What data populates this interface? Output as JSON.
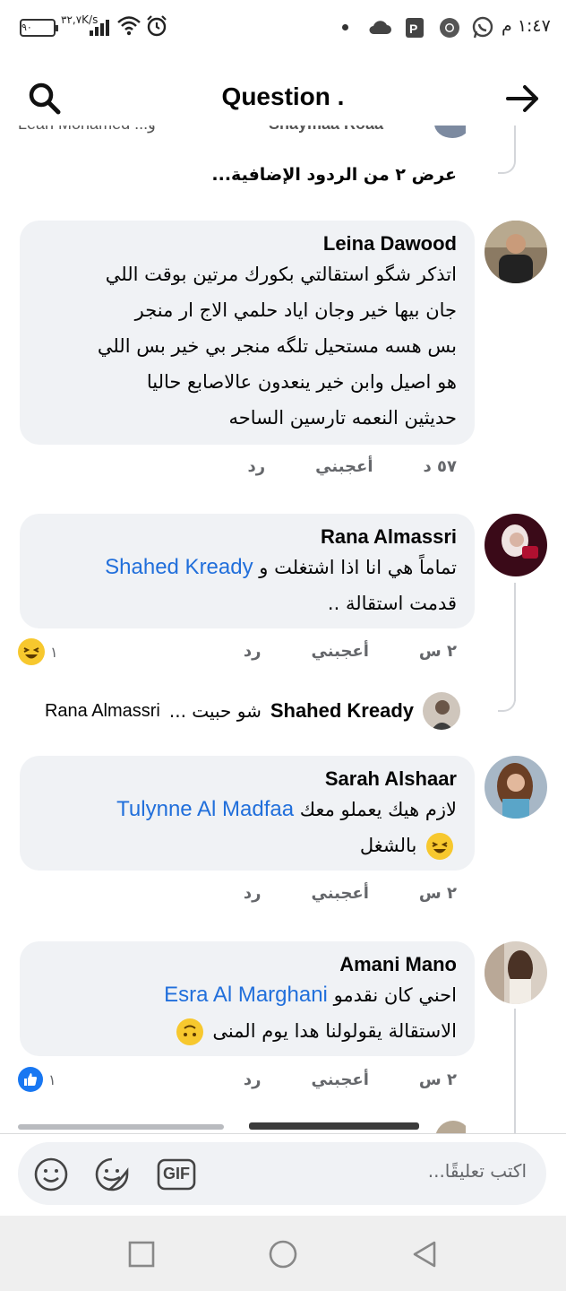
{
  "status_bar": {
    "battery": "٩٠",
    "net_speed_value": "٣٢,٧",
    "net_speed_unit": "K/s",
    "time": "١:٤٧ م",
    "icons": [
      "signal-icon",
      "wifi-icon",
      "alarm-icon",
      "cloud-icon",
      "powerpoint-icon",
      "chrome-icon",
      "whatsapp-icon"
    ]
  },
  "header": {
    "title": "Question ."
  },
  "thread": {
    "partial_top_left": "Lean Mohamed ...و",
    "partial_top_right": "Shaymaa Roaa",
    "more_replies": "عرض ٢ من الردود الإضافية...",
    "comments": [
      {
        "name": "Leina Dawood",
        "lines": [
          "اتذكر شگو استقالتي بكورك مرتين بوقت اللي",
          "جان بيها خير وجان اياد حلمي الاج ار منجر",
          "بس هسه مستحيل تلگه منجر بي خير بس اللي",
          "هو اصيل وابن خير ينعدون عالاصابع حاليا",
          "حديثين النعمه تارسين الساحه"
        ],
        "time": "٥٧ د",
        "like": "أعجبني",
        "reply": "رد"
      },
      {
        "name": "Rana Almassri",
        "line1_text": "تماماً هي انا اذا اشتغلت و",
        "line1_mention": "Shahed Kready",
        "line2": "قدمت استقالة ..",
        "time": "٢ س",
        "like": "أعجبني",
        "reply": "رد",
        "reaction_count": "١"
      },
      {
        "name": "Sarah Alshaar",
        "line1_text": "لازم هيك يعملو معك",
        "line1_mention": "Tulynne Al Madfaa",
        "line2": "بالشغل",
        "time": "٢ س",
        "like": "أعجبني",
        "reply": "رد"
      },
      {
        "name": "Amani Mano",
        "line1_text": "احني كان نقدمو",
        "line1_mention": "Esra Al Marghani",
        "line2": "الاستقالة يقولولنا هدا يوم المنى",
        "time": "٢ س",
        "like": "أعجبني",
        "reply": "رد",
        "reaction_count": "١"
      }
    ],
    "reply_preview": {
      "name": "Shahed Kready",
      "text": "شو حبيت ...",
      "mention": "Rana Almassri"
    }
  },
  "composer": {
    "placeholder": "اكتب تعليقًا...",
    "gif_label": "GIF"
  },
  "colors": {
    "bubble_bg": "#f0f2f5",
    "mention": "#216fdb",
    "meta_text": "#65676b",
    "like_blue": "#1877f2"
  }
}
